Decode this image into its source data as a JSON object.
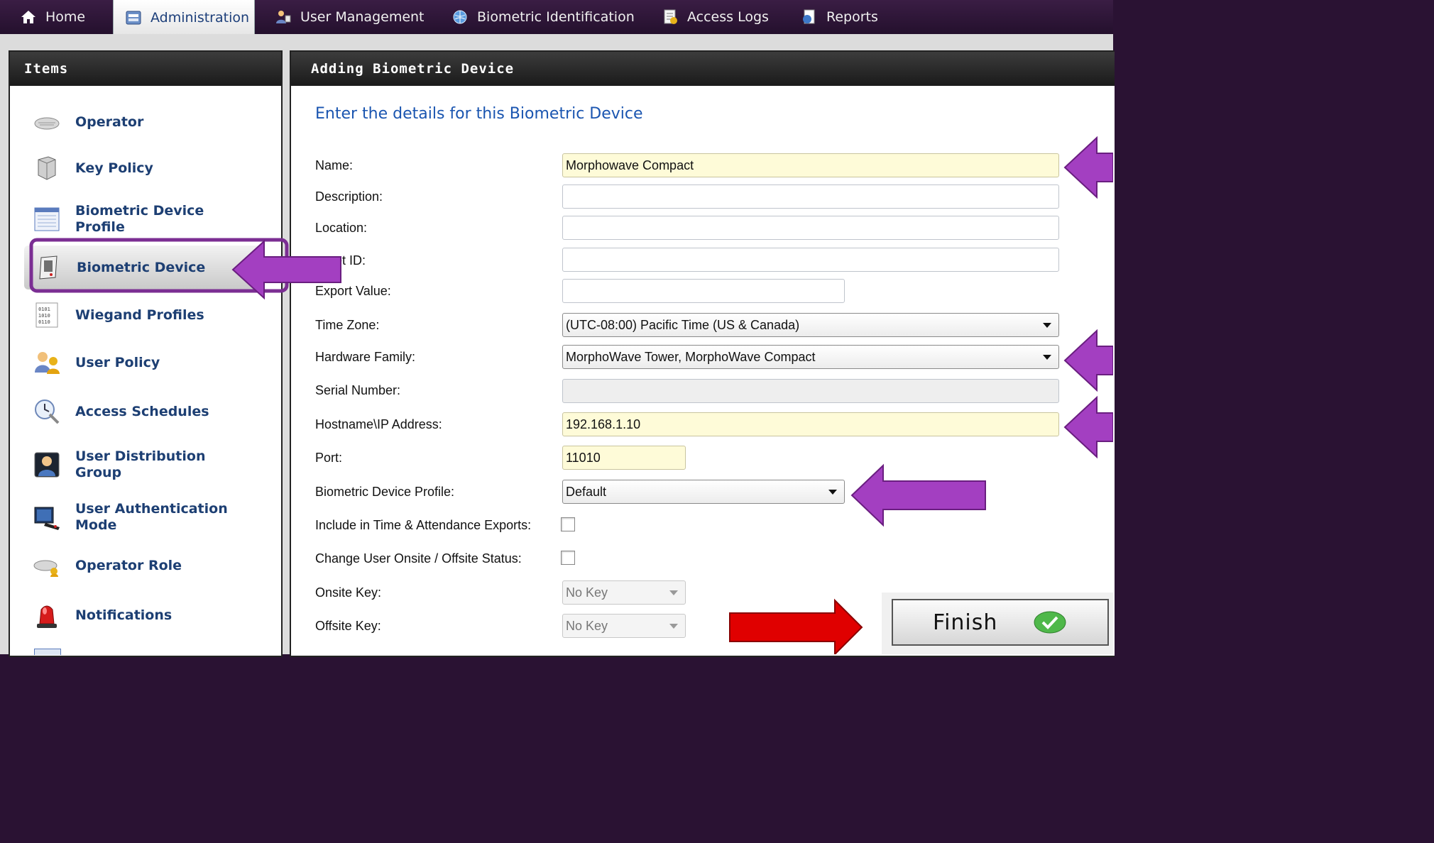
{
  "nav": {
    "tabs": [
      {
        "label": "Home",
        "icon": "home-icon"
      },
      {
        "label": "Administration",
        "icon": "administration-icon",
        "active": true
      },
      {
        "label": "User Management",
        "icon": "user-management-icon"
      },
      {
        "label": "Biometric Identification",
        "icon": "globe-icon"
      },
      {
        "label": "Access Logs",
        "icon": "access-logs-icon"
      },
      {
        "label": "Reports",
        "icon": "reports-icon"
      }
    ]
  },
  "sidebar": {
    "title": "Items",
    "items": [
      {
        "label": "Operator",
        "icon": "keyboard-icon"
      },
      {
        "label": "Key Policy",
        "icon": "key-policy-icon"
      },
      {
        "label": "Biometric Device Profile",
        "icon": "device-profile-icon"
      },
      {
        "label": "Biometric Device",
        "icon": "biometric-device-icon",
        "selected": true
      },
      {
        "label": "Wiegand Profiles",
        "icon": "wiegand-icon"
      },
      {
        "label": "User Policy",
        "icon": "user-policy-icon"
      },
      {
        "label": "Access Schedules",
        "icon": "access-schedules-icon"
      },
      {
        "label": "User Distribution Group",
        "icon": "distribution-group-icon"
      },
      {
        "label": "User Authentication Mode",
        "icon": "authentication-mode-icon"
      },
      {
        "label": "Operator Role",
        "icon": "operator-role-icon"
      },
      {
        "label": "Notifications",
        "icon": "siren-icon"
      }
    ]
  },
  "form": {
    "header": "Adding Biometric Device",
    "intro": "Enter the details for this Biometric Device",
    "labels": {
      "name": "Name:",
      "description": "Description:",
      "location": "Location:",
      "asset_id": "et ID:",
      "export_value": "Export Value:",
      "time_zone": "Time Zone:",
      "hardware_family": "Hardware Family:",
      "serial_number": "Serial Number:",
      "hostname": "Hostname\\IP Address:",
      "port": "Port:",
      "profile": "Biometric Device Profile:",
      "include_ta": "Include in Time & Attendance Exports:",
      "change_onsite": "Change User Onsite / Offsite Status:",
      "onsite_key": "Onsite Key:",
      "offsite_key": "Offsite Key:"
    },
    "values": {
      "name": "Morphowave Compact",
      "description": "",
      "location": "",
      "asset_id": "",
      "export_value": "",
      "time_zone": "(UTC-08:00) Pacific Time (US & Canada)",
      "hardware_family": "MorphoWave Tower, MorphoWave Compact",
      "serial_number": "",
      "hostname": "192.168.1.10",
      "port": "11010",
      "profile": "Default",
      "include_ta": false,
      "change_onsite": false,
      "onsite_key": "No Key",
      "offsite_key": "No Key"
    },
    "finish_label": "Finish"
  },
  "annotation_colors": {
    "purple_arrow": "#a33fc1",
    "red_arrow": "#e00000",
    "highlight_box": "#7b2e93"
  }
}
